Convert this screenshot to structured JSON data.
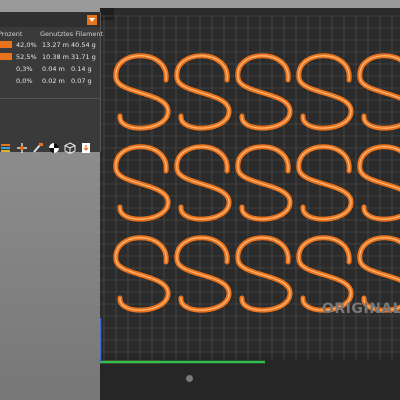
{
  "stats_panel": {
    "header_percent": "Prozent",
    "header_filament": "Genutztes Filament",
    "rows": [
      {
        "percent": "42,0%",
        "length": "13.27 m",
        "weight": "40.54 g",
        "swatch": "#e9731d"
      },
      {
        "percent": "52,5%",
        "length": "10.38 m",
        "weight": "31.71 g",
        "swatch": "#e9731d"
      },
      {
        "percent": "0,3%",
        "length": "0.04 m",
        "weight": "0.14 g",
        "swatch": null
      },
      {
        "percent": "0,0%",
        "length": "0.02 m",
        "weight": "0.07 g",
        "swatch": null
      }
    ],
    "collapse_icon": "chevron-down-icon"
  },
  "toolbar": {
    "icons": [
      "layers-icon",
      "move-icon",
      "brush-icon",
      "color-wheel-icon",
      "cube-icon",
      "export-icon"
    ]
  },
  "viewport": {
    "bed_logo": "ORIGINAL P",
    "print_color": "#e9731d",
    "bed_color": "#2b2b2b",
    "axis_colors": {
      "x": "#d43a3a",
      "y": "#2fbf4a",
      "z": "#3b6bd6"
    }
  }
}
